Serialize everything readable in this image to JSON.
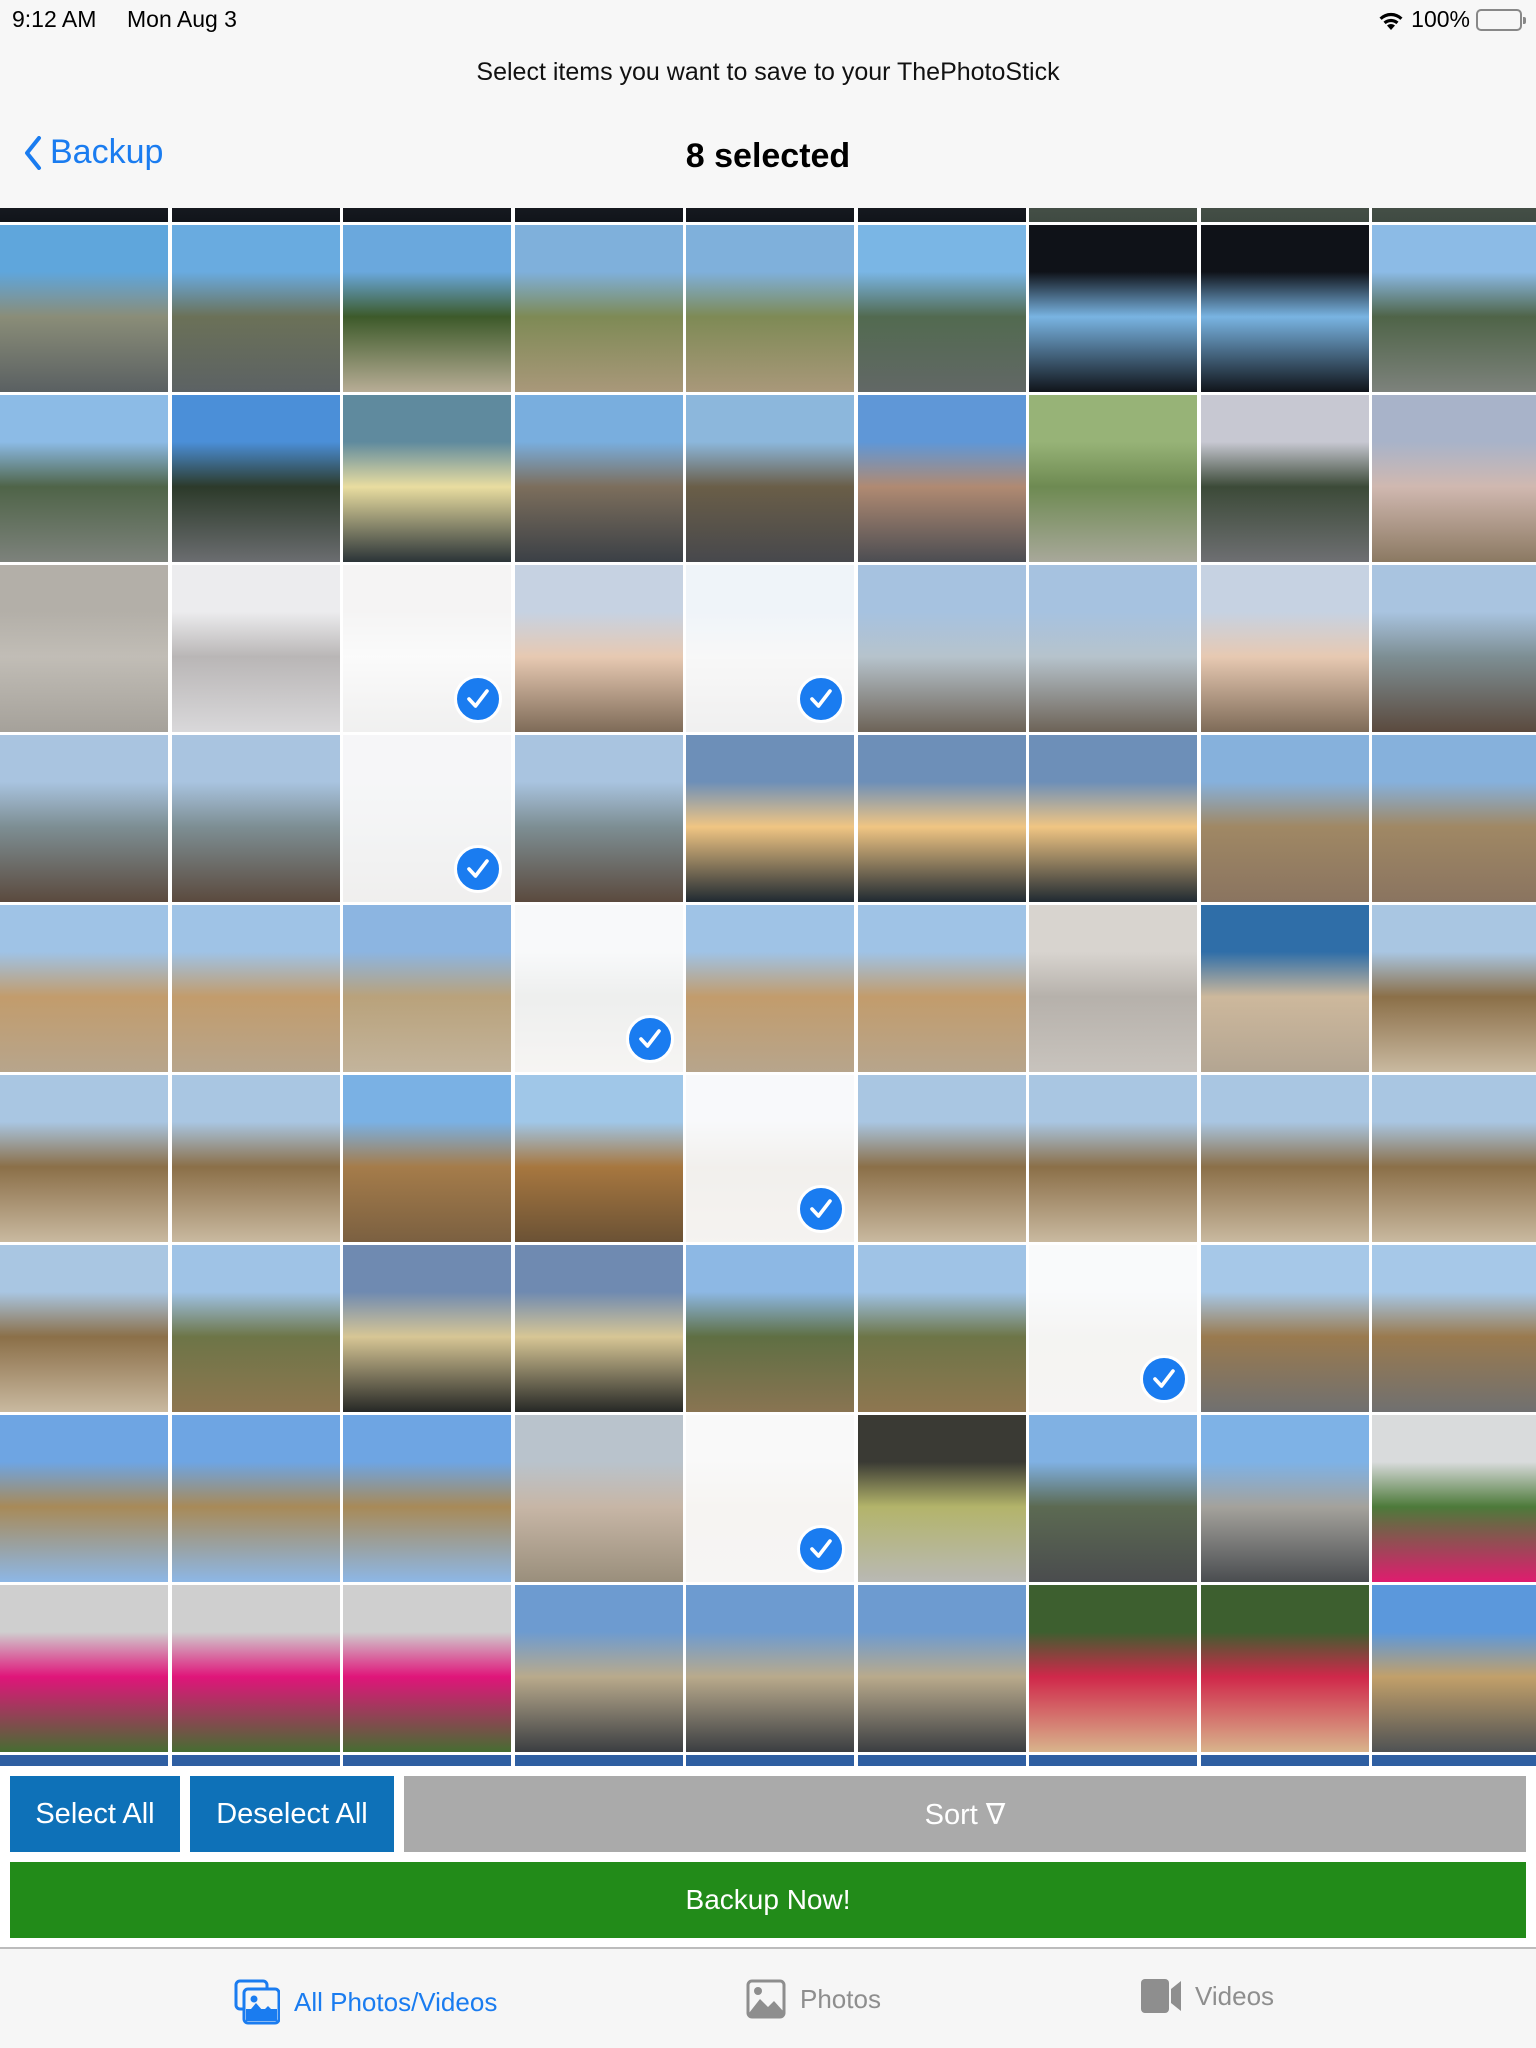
{
  "status_bar": {
    "time": "9:12 AM",
    "date": "Mon Aug 3",
    "battery": "100%"
  },
  "header": {
    "subtitle": "Select items you want to save to your ThePhotoStick",
    "back_label": "Backup",
    "title": "8 selected"
  },
  "colors": {
    "accent": "#1a7cf0",
    "select_button": "#0e71b8",
    "sort_button": "#aaaaaa",
    "backup_button": "#228b19",
    "tab_inactive": "#8e8e8e"
  },
  "grid": {
    "columns": 9,
    "selected_count": 8,
    "rows": [
      {
        "label": "clipped-top",
        "tiles": [
          "car-interior",
          "car-interior",
          "car-interior",
          "car-interior",
          "car-interior",
          "car-interior",
          "road",
          "road",
          "road"
        ]
      },
      {
        "label": "highway",
        "tiles": [
          "highway",
          "highway-pole",
          "orchard",
          "hillside-cactus",
          "hillside-cactus",
          "highway-mountain",
          "car-window-mountain",
          "car-window-mountain",
          "overpass-town"
        ]
      },
      {
        "label": "town",
        "tiles": [
          "overpass-town",
          "palm-lot",
          "sunset-signal",
          "street-signals",
          "street-trees",
          "palm-street",
          "cactus",
          "palm-parking",
          "beach-dusk"
        ]
      },
      {
        "label": "sand",
        "tiles": [
          "sand-prints",
          "sand-ripples",
          "sand-light",
          "beach-headland",
          "beach-shore",
          "beach-rocks",
          "beach-rocks",
          "beach-headland",
          "jetty"
        ]
      },
      {
        "label": "jetty",
        "tiles": [
          "jetty",
          "jetty",
          "jetty-light",
          "jetty",
          "sunset-shore",
          "sunset-shore",
          "sunset-shore",
          "beach-town",
          "beach-town"
        ]
      },
      {
        "label": "dunes",
        "tiles": [
          "dunes",
          "dunes",
          "dunes-trees",
          "dunes-trees-light",
          "dunes",
          "dunes",
          "sand-closeup",
          "beach-dusk-dune",
          "dune-path"
        ]
      },
      {
        "label": "paths",
        "tiles": [
          "dune-path",
          "dune-path",
          "dune-fence",
          "dune-hill",
          "dune-hill-light",
          "dune-path",
          "dune-path",
          "dune-path",
          "dune-path"
        ]
      },
      {
        "label": "field",
        "tiles": [
          "dune-path",
          "field",
          "bike-path-sun",
          "bike-path-sun",
          "field-palm",
          "field",
          "field-light",
          "bike-path",
          "bike-path"
        ]
      },
      {
        "label": "palms",
        "tiles": [
          "palm-sky",
          "palm-sky",
          "palm-sky",
          "shed",
          "shed-light",
          "cactus-sidewalk",
          "street-palm",
          "street-houses",
          "pink-flower-bush"
        ]
      },
      {
        "label": "flowers",
        "tiles": [
          "pink-geranium",
          "pink-geranium",
          "pink-geranium",
          "street-dusk",
          "street-dusk",
          "street-dusk",
          "bougainvillea",
          "bougainvillea",
          "street-buildings"
        ]
      },
      {
        "label": "clipped-bottom",
        "tiles": [
          "sky-blue",
          "sky-blue",
          "sky-blue",
          "sky-blue",
          "sky-blue",
          "sky-blue",
          "sky-blue",
          "sky-blue",
          "sky-blue"
        ]
      }
    ],
    "selected": [
      [
        3,
        2
      ],
      [
        3,
        4
      ],
      [
        4,
        2
      ],
      [
        5,
        3
      ],
      [
        6,
        4
      ],
      [
        7,
        6
      ],
      [
        8,
        4
      ]
    ]
  },
  "scenes": {
    "car-interior": [
      "#0b0c10",
      "#2a2f36",
      "#11141a"
    ],
    "road": [
      "#4b554b",
      "#5b6458",
      "#3f4a42"
    ],
    "highway": [
      "#5fa6dc",
      "#8a8d78",
      "#5a6062"
    ],
    "highway-pole": [
      "#69abe0",
      "#6b7158",
      "#5c6264"
    ],
    "orchard": [
      "#6aa8dd",
      "#3d5a2a",
      "#b8ad96"
    ],
    "hillside-cactus": [
      "#7fb0db",
      "#7e8a55",
      "#a9987a"
    ],
    "highway-mountain": [
      "#7ab6e5",
      "#526a50",
      "#626866"
    ],
    "car-window-mountain": [
      "#0f1218",
      "#79b4e2",
      "#10141a"
    ],
    "overpass-town": [
      "#8cbbe6",
      "#4f6448",
      "#7d827c"
    ],
    "palm-lot": [
      "#4b8fd8",
      "#2c3a2a",
      "#6b6d70"
    ],
    "sunset-signal": [
      "#5f8a9e",
      "#e9dda0",
      "#2b3438"
    ],
    "street-signals": [
      "#79aede",
      "#7c6e5c",
      "#3b4046"
    ],
    "street-trees": [
      "#8cb7dc",
      "#6a5e48",
      "#47484c"
    ],
    "palm-street": [
      "#5f97d7",
      "#b08a72",
      "#4c4d52"
    ],
    "cactus": [
      "#97b377",
      "#6e8a52",
      "#a8a89a"
    ],
    "palm-parking": [
      "#c7c8d2",
      "#3c4a38",
      "#6e6f72"
    ],
    "beach-dusk": [
      "#a8b3c9",
      "#d0b8b0",
      "#8b7962"
    ],
    "sand-prints": [
      "#b3afa8",
      "#c1bdb6",
      "#a5a19a"
    ],
    "sand-ripples": [
      "#ececee",
      "#b9b6b6",
      "#d9d8da"
    ],
    "sand-light": [
      "#e4e3e3",
      "#f3f3f3",
      "#d8d7d6"
    ],
    "beach-headland": [
      "#c6d2e2",
      "#e7c9b2",
      "#7e6b58"
    ],
    "beach-shore": [
      "#d5e2ef",
      "#ececec",
      "#d7d6d6"
    ],
    "beach-rocks": [
      "#a6c2e0",
      "#b6c3cc",
      "#6d6357"
    ],
    "jetty": [
      "#a9c4e0",
      "#7d8e93",
      "#5b4a3e"
    ],
    "jetty-light": [
      "#e6e8ec",
      "#e0e2e4",
      "#d6d4d2"
    ],
    "sunset-shore": [
      "#6d8fb8",
      "#f0c583",
      "#202a32"
    ],
    "beach-town": [
      "#86b1dc",
      "#a08864",
      "#8a7460"
    ],
    "dunes": [
      "#9fc3e6",
      "#c29c6c",
      "#b7a58c"
    ],
    "dunes-trees": [
      "#8cb5e1",
      "#b9a27b",
      "#c3b49c"
    ],
    "dunes-trees-light": [
      "#eceff2",
      "#d1d4d2",
      "#e7e4e0"
    ],
    "sand-closeup": [
      "#d8d4cf",
      "#b6b1ab",
      "#c8c3bd"
    ],
    "beach-dusk-dune": [
      "#2f6ea8",
      "#cdb89c",
      "#b3a592"
    ],
    "dune-path": [
      "#a9c6e2",
      "#8b6f48",
      "#c9b9a0"
    ],
    "dune-fence": [
      "#7ab1e4",
      "#a57c4a",
      "#7b6041"
    ],
    "dune-hill": [
      "#a0c7e8",
      "#a7773f",
      "#6b5235"
    ],
    "dune-hill-light": [
      "#eceff3",
      "#dcd6ce",
      "#e4dfd8"
    ],
    "field": [
      "#9fc3e6",
      "#6d7547",
      "#8e7650"
    ],
    "bike-path-sun": [
      "#6f8ab1",
      "#d7c695",
      "#262826"
    ],
    "field-palm": [
      "#8db8e4",
      "#5f6f43",
      "#897452"
    ],
    "field-light": [
      "#eef1f4",
      "#e3e1de",
      "#e6e3df"
    ],
    "bike-path": [
      "#a6c8e8",
      "#9a7a4e",
      "#707070"
    ],
    "palm-sky": [
      "#6ea5e3",
      "#a88a58",
      "#8db7e6"
    ],
    "shed": [
      "#b9c3cc",
      "#c7b6a6",
      "#9a8f7c"
    ],
    "shed-light": [
      "#eeeeee",
      "#e8e3dd",
      "#e6e4e1"
    ],
    "cactus-sidewalk": [
      "#3a3a34",
      "#b3b46a",
      "#b9b9b4"
    ],
    "street-palm": [
      "#80b1e3",
      "#5c6a52",
      "#4a4c4e"
    ],
    "street-houses": [
      "#7eb2e6",
      "#a4a29c",
      "#4a4d50"
    ],
    "pink-flower-bush": [
      "#d9dbdc",
      "#4d7a3a",
      "#e01c6f"
    ],
    "pink-geranium": [
      "#cfcfcf",
      "#e0157a",
      "#466d32"
    ],
    "street-dusk": [
      "#6d9bd0",
      "#b9aa8c",
      "#3b3e42"
    ],
    "bougainvillea": [
      "#3d5f2f",
      "#d0284a",
      "#d8b48c"
    ],
    "street-buildings": [
      "#5b98dc",
      "#c2a06a",
      "#4f5254"
    ],
    "sky-blue": [
      "#2f5fa2",
      "#6f9ad0",
      "#3b66a8"
    ]
  },
  "actions": {
    "select_all": "Select All",
    "deselect_all": "Deselect All",
    "sort": "Sort ∇",
    "backup_now": "Backup Now!"
  },
  "tabs": [
    {
      "label": "All Photos/Videos",
      "icon": "photo-stack-icon",
      "active": true
    },
    {
      "label": "Photos",
      "icon": "photo-icon",
      "active": false
    },
    {
      "label": "Videos",
      "icon": "video-camera-icon",
      "active": false
    }
  ]
}
